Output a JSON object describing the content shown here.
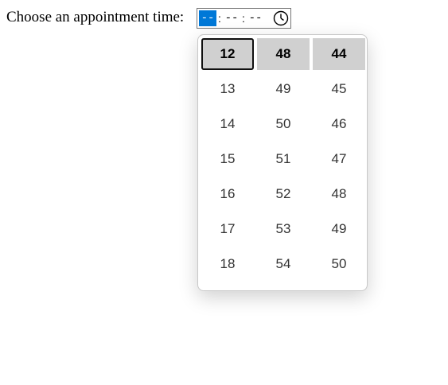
{
  "form": {
    "label": "Choose an appointment time:"
  },
  "time_input": {
    "hour": "--",
    "minute": "--",
    "second": "--",
    "separator": ":",
    "icon": "clock-icon",
    "highlight_color": "#0078d7"
  },
  "picker": {
    "hours": [
      "12",
      "13",
      "14",
      "15",
      "16",
      "17",
      "18"
    ],
    "minutes": [
      "48",
      "49",
      "50",
      "51",
      "52",
      "53",
      "54"
    ],
    "seconds": [
      "44",
      "45",
      "46",
      "47",
      "48",
      "49",
      "50"
    ],
    "selected_hour": "12",
    "selected_minute": "48",
    "selected_second": "44",
    "selected_bg": "#d0d0d0"
  }
}
